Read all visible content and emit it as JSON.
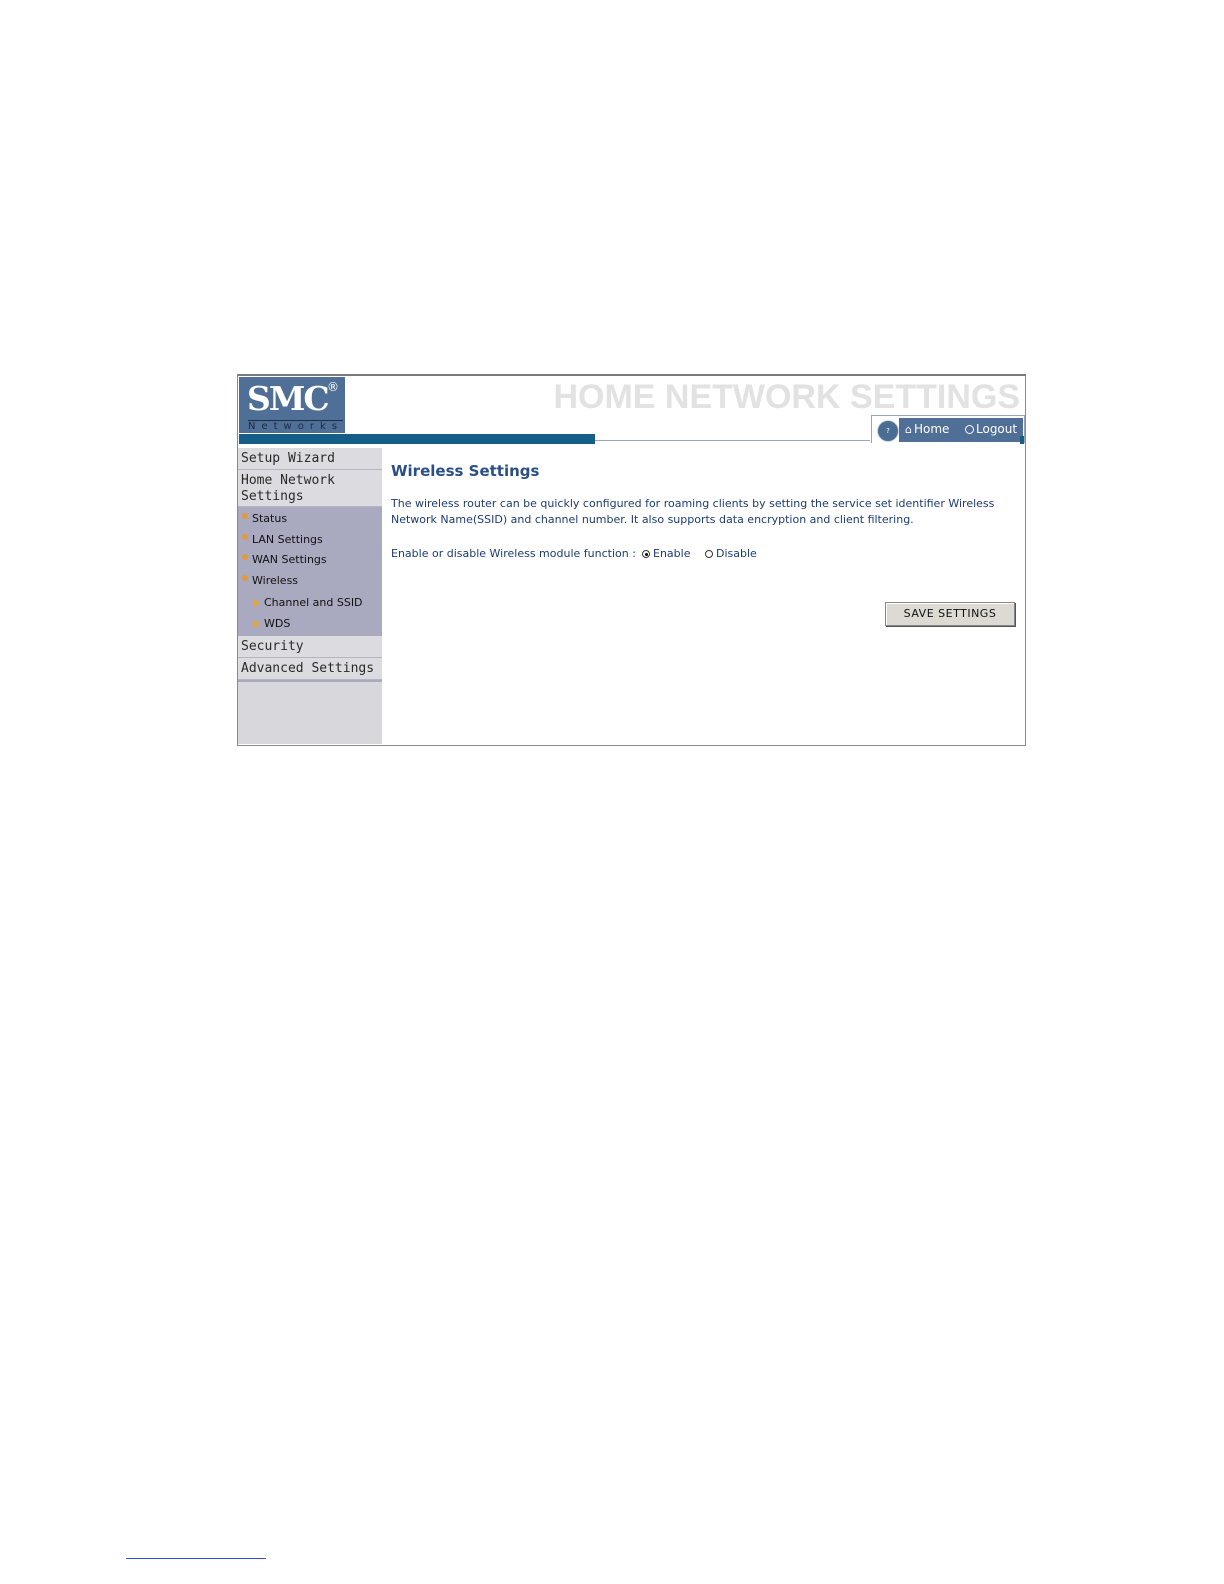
{
  "header": {
    "logo_text": "SMC",
    "logo_registered": "®",
    "logo_subtext": "Networks",
    "title": "HOME NETWORK SETTINGS",
    "help_icon": "help-icon",
    "home_label": "Home",
    "logout_label": "Logout"
  },
  "sidebar": {
    "setup_wizard": "Setup Wizard",
    "home_network_settings": "Home Network Settings",
    "items": [
      {
        "label": "Status"
      },
      {
        "label": "LAN Settings"
      },
      {
        "label": "WAN Settings"
      },
      {
        "label": "Wireless"
      }
    ],
    "subitems": [
      {
        "label": "Channel and SSID"
      },
      {
        "label": "WDS"
      }
    ],
    "security": "Security",
    "advanced_settings": "Advanced Settings"
  },
  "main": {
    "title": "Wireless Settings",
    "description": "The wireless router can be quickly configured for roaming clients by setting the service set identifier Wireless Network Name(SSID) and channel number. It also supports data encryption and client filtering.",
    "enable_label": "Enable or disable Wireless module function :",
    "radio_enable": "Enable",
    "radio_disable": "Disable",
    "selected": "Enable",
    "save_button": "SAVE SETTINGS"
  },
  "colors": {
    "brand_blue": "#4f6f96",
    "accent_teal": "#155e88",
    "sidebar_bg": "#a9a9c0",
    "text_blue": "#1c3c72"
  }
}
